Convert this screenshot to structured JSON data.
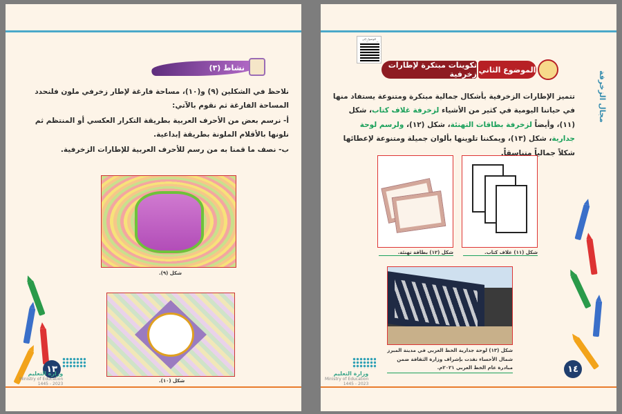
{
  "left_page": {
    "activity_label": "نشاط (٣)",
    "intro": "نلاحظ في الشكلين (٩) و(١٠)، مساحة فارغة لإطار زخرفي ملون فلنحدد المساحة الفارغة ثم نقوم بالآتي:",
    "step_a": "أ- نرسم بعض من الأحرف العربية بطريقة التكرار العكسي أو المنتظم ثم نلونها بالأقلام الملونة بطريقة إبداعية.",
    "step_b": "ب- نصف ما قمنا به من رسم للأحرف العربية للإطارات الزخرفية.",
    "caption_9": "شكل (٩).",
    "caption_10": "شكل (١٠).",
    "page_number": "١٣",
    "ministry": "وزارة التعليم",
    "ministry_sub": "Ministry of Education",
    "year": "2023 - 1445"
  },
  "right_page": {
    "qr_text": "للوصول إلى المحتوى الرقمي",
    "topic_label": "الموضوع الثاني",
    "topic_title": "تكوينات مبتكرة لإطارات زخرفية",
    "para_1": "تتميز الإطارات الزخرفية بأشكال جمالية مبتكرة ومتنوعة يستفاد منها في حياتنا اليومية في كثير من الأشياء ",
    "para_hl_1": "لزخرفة غلاف كتاب",
    "para_2": "، شكل (١١)، وأيضاً ",
    "para_hl_2": "لزخرفة بطاقات التهنئة",
    "para_3": "، شكل (١٢)، ",
    "para_hl_3": "ولرسم لوحة جدارية",
    "para_4": "، شكل (١٣)، ويمكننا تلوينها بألوان جميلة ومتنوعة لإعطائها شكلاً جمالياً متناسقاً.",
    "caption_11": "شكل (١١) غلاف كتاب.",
    "caption_12": "شكل (١٢) بطاقة تهنئة.",
    "caption_13": "شكل (١٣) لوحة جدارية الخط العربي في مدينة المبرز شمال الأحساء نفذت بإشراف وزارة الثقافة ضمن مبادرة عام الخط العربي ٢٠٢١م.",
    "page_number": "١٤",
    "side_label": "مجال الزخرفة",
    "ministry": "وزارة التعليم",
    "ministry_sub": "Ministry of Education",
    "year": "2023 - 1445"
  },
  "colors": {
    "accent_blue": "#4aa8c9",
    "accent_orange": "#e87a2a",
    "topic_red": "#b72025",
    "highlight_green": "#19a05a",
    "page_number_navy": "#1f3e6e"
  }
}
